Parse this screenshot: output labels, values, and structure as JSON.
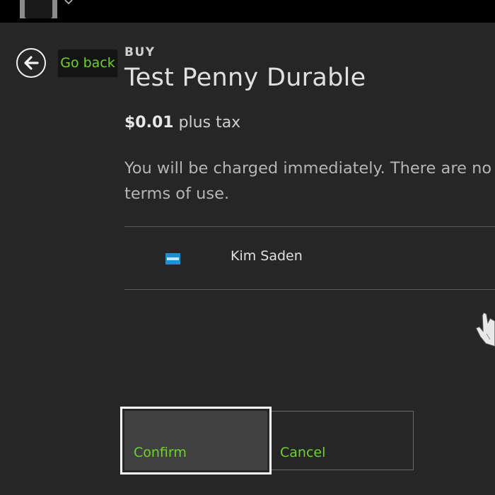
{
  "topbar": {
    "avatar_icon": "user-avatar-icon",
    "menu_icon": "chevron-down-icon"
  },
  "nav": {
    "back_icon": "arrow-left-icon",
    "back_label": "Go back"
  },
  "purchase": {
    "section_label": "BUY",
    "product_title": "Test Penny Durable",
    "price": "$0.01",
    "price_suffix": " plus tax",
    "notice": "You will be charged immediately. There are no re",
    "notice_line2": "terms of use."
  },
  "payment": {
    "card_icon": "american-express-card-icon",
    "name": "Kim Saden"
  },
  "actions": {
    "confirm_label": "Confirm",
    "cancel_label": "Cancel"
  },
  "colors": {
    "background": "#262626",
    "accent": "#6fd12e",
    "topbar": "#000000",
    "confirm_fill": "#404040"
  }
}
